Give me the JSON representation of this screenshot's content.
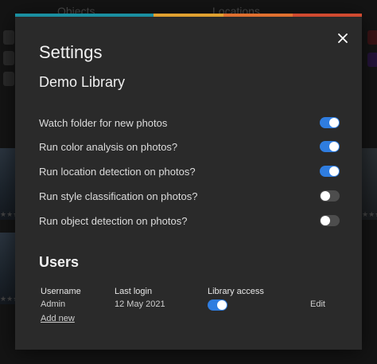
{
  "background": {
    "tabs": [
      "Objects",
      "Locations"
    ],
    "stars": "★★★"
  },
  "modal": {
    "accent_colors": [
      "#1a8fa0",
      "#1a8fa0",
      "#e0a030",
      "#e07030",
      "#d04a30"
    ],
    "title": "Settings",
    "library_name": "Demo Library",
    "settings": [
      {
        "label": "Watch folder for new photos",
        "enabled": true
      },
      {
        "label": "Run color analysis on photos?",
        "enabled": true
      },
      {
        "label": "Run location detection on photos?",
        "enabled": true
      },
      {
        "label": "Run style classification on photos?",
        "enabled": false
      },
      {
        "label": "Run object detection on photos?",
        "enabled": false
      }
    ],
    "users": {
      "heading": "Users",
      "columns": {
        "username": "Username",
        "last_login": "Last login",
        "library_access": "Library access"
      },
      "rows": [
        {
          "username": "Admin",
          "last_login": "12 May 2021",
          "library_access": true,
          "edit_label": "Edit"
        }
      ],
      "add_new_label": "Add new"
    },
    "toggle_on_color": "#2f7de0",
    "toggle_off_color": "#4d4d4d"
  }
}
